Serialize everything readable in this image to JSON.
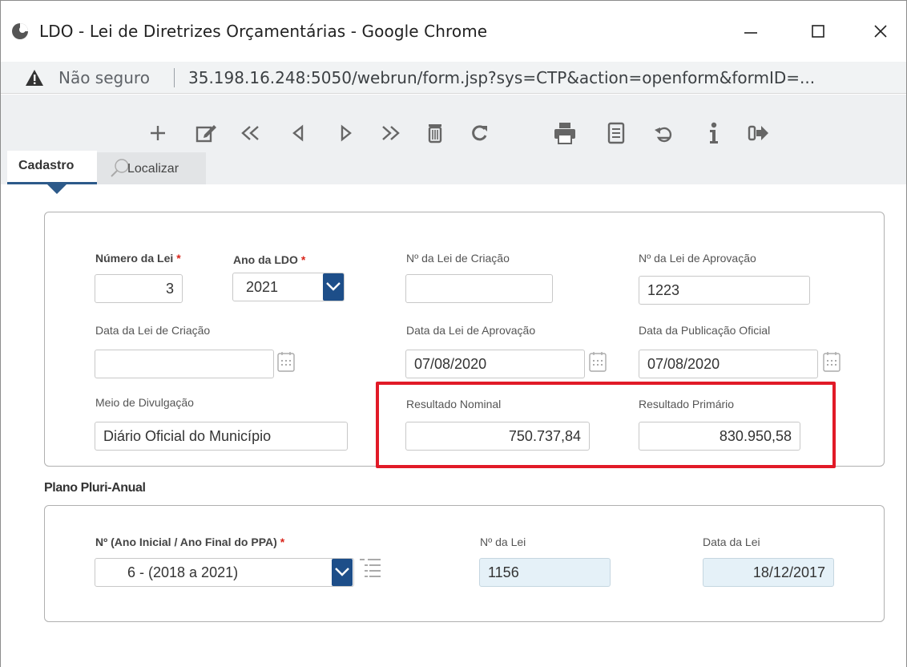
{
  "window": {
    "title": "LDO - Lei de Diretrizes Orçamentárias - Google Chrome"
  },
  "address_bar": {
    "security_label": "Não seguro",
    "url": "35.198.16.248:5050/webrun/form.jsp?sys=CTP&action=openform&formID=..."
  },
  "toolbar": {
    "buttons": [
      "plus-icon",
      "edit-icon",
      "first-record-icon",
      "previous-record-icon",
      "next-record-icon",
      "last-record-icon",
      "trash-icon",
      "refresh-icon",
      "print-icon",
      "report-icon",
      "undo-icon",
      "info-icon",
      "exit-icon"
    ]
  },
  "tabs": [
    {
      "label": "Cadastro",
      "active": true
    },
    {
      "label": "Localizar",
      "active": false
    }
  ],
  "form": {
    "numero_lei": {
      "label": "Número da Lei",
      "required": "*",
      "value": "3"
    },
    "ano_ldo": {
      "label": "Ano da LDO",
      "required": "*",
      "value": "2021"
    },
    "num_lei_criacao": {
      "label": "Nº da Lei de Criação",
      "value": ""
    },
    "num_lei_aprovacao": {
      "label": "Nº da Lei de Aprovação",
      "value": "1223"
    },
    "data_lei_criacao": {
      "label": "Data da Lei de Criação",
      "value": ""
    },
    "data_lei_aprovacao": {
      "label": "Data da Lei de Aprovação",
      "value": "07/08/2020"
    },
    "data_publicacao": {
      "label": "Data da Publicação Oficial",
      "value": "07/08/2020"
    },
    "meio_divulgacao": {
      "label": "Meio de Divulgação",
      "value": "Diário Oficial do Município"
    },
    "resultado_nominal": {
      "label": "Resultado Nominal",
      "value": "750.737,84"
    },
    "resultado_primario": {
      "label": "Resultado Primário",
      "value": "830.950,58"
    }
  },
  "ppa": {
    "section_title": "Plano Pluri-Anual",
    "ppa_select": {
      "label": "Nº (Ano Inicial / Ano Final do PPA)",
      "required": "*",
      "value": "6 - (2018 a 2021)"
    },
    "num_lei": {
      "label": "Nº da Lei",
      "value": "1156"
    },
    "data_lei": {
      "label": "Data da Lei",
      "value": "18/12/2017"
    }
  },
  "colors": {
    "accent": "#1d4e89",
    "highlight": "#e11a27",
    "required": "#d9261c",
    "readonly_bg": "#e5f1f8"
  }
}
